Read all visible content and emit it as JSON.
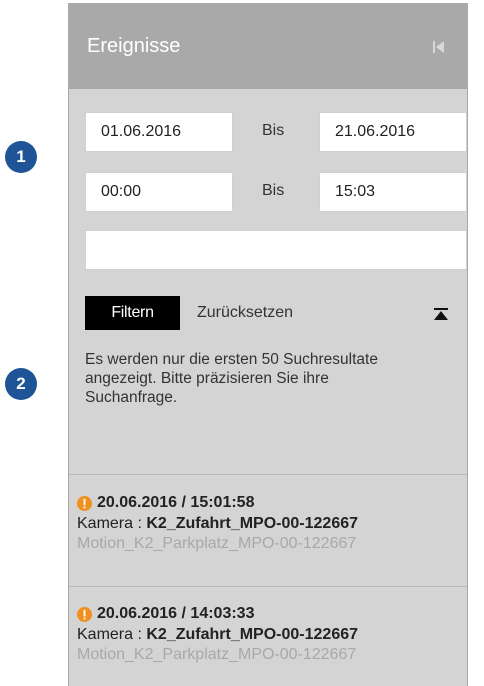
{
  "callouts": [
    "1",
    "2"
  ],
  "panel": {
    "title": "Ereignisse",
    "collapse_icon": "skip-to-start-icon"
  },
  "filter": {
    "date_from": "01.06.2016",
    "date_to": "21.06.2016",
    "time_from": "00:00",
    "time_to": "15:03",
    "separator": "Bis",
    "text_value": "",
    "filter_label": "Filtern",
    "reset_label": "Zurücksetzen",
    "collapse_icon": "collapse-up-icon",
    "info": "Es werden nur die ersten 50 Suchresultate angezeigt. Bitte präzisieren Sie ihre Suchanfrage."
  },
  "events": [
    {
      "datetime": "20.06.2016 / 15:01:58",
      "camera_label": "Kamera :",
      "camera": "K2_Zufahrt_MPO-00-122667",
      "detail": "Motion_K2_Parkplatz_MPO-00-122667"
    },
    {
      "datetime": "20.06.2016 / 14:03:33",
      "camera_label": "Kamera :",
      "camera": "K2_Zufahrt_MPO-00-122667",
      "detail": "Motion_K2_Parkplatz_MPO-00-122667"
    }
  ],
  "colors": {
    "callout": "#1f5596",
    "warning": "#f0901e",
    "header": "#a9a9a9",
    "panel": "#d4d4d4"
  }
}
